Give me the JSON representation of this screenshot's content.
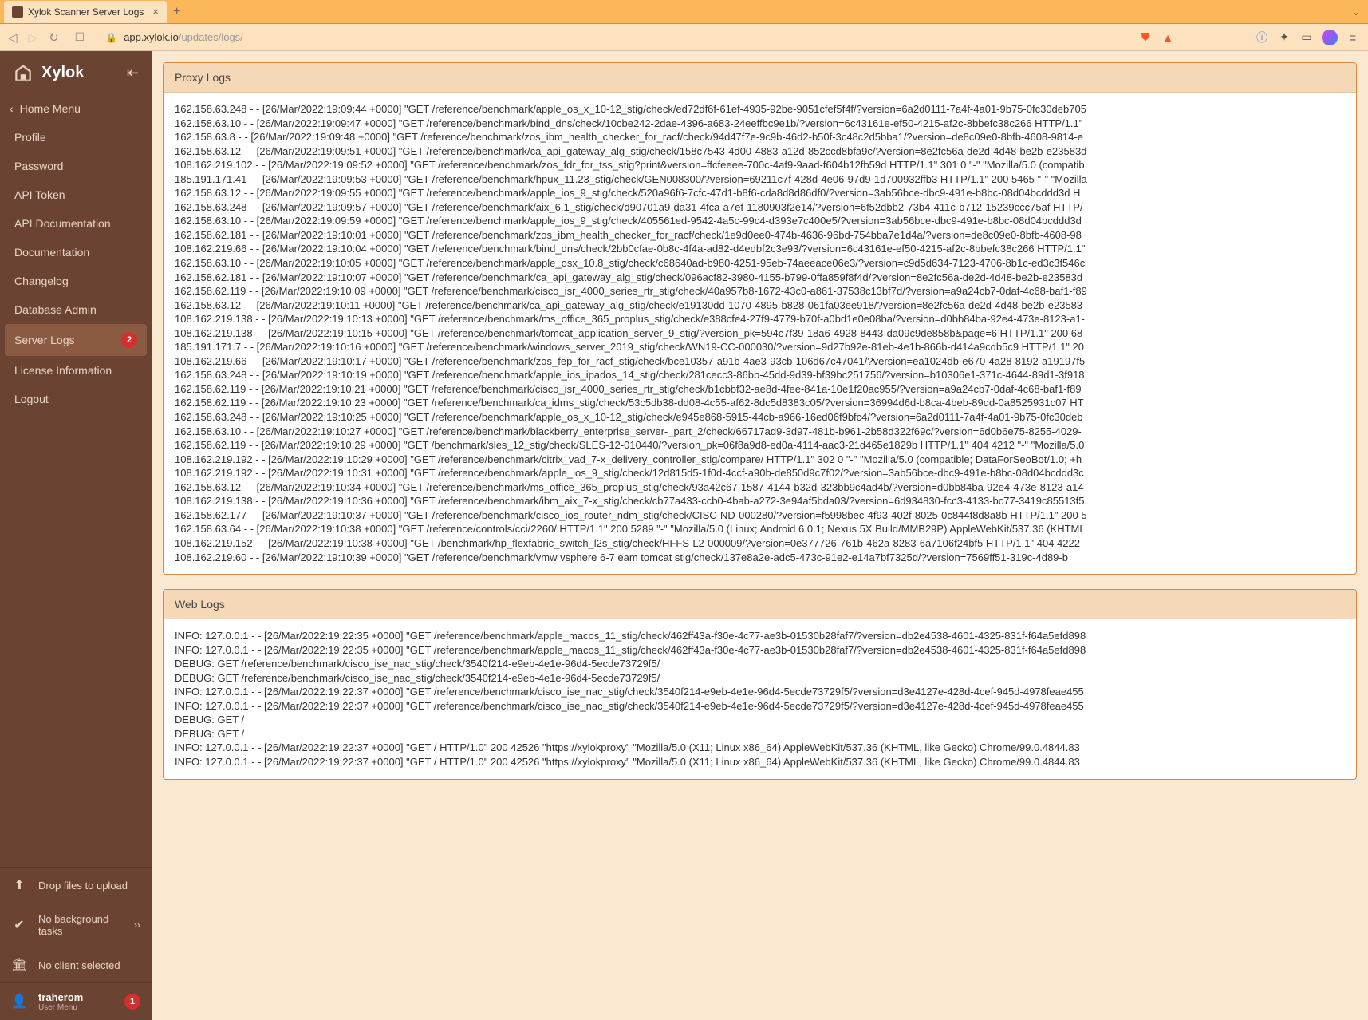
{
  "browser": {
    "tab_title": "Xylok Scanner Server Logs",
    "url_domain": "app.xylok.io",
    "url_path": "/updates/logs/"
  },
  "sidebar": {
    "brand": "Xylok",
    "home": "Home Menu",
    "items": [
      {
        "label": "Profile"
      },
      {
        "label": "Password"
      },
      {
        "label": "API Token"
      },
      {
        "label": "API Documentation"
      },
      {
        "label": "Documentation"
      },
      {
        "label": "Changelog"
      },
      {
        "label": "Database Admin"
      },
      {
        "label": "Server Logs",
        "badge": "2",
        "active": true
      },
      {
        "label": "License Information"
      },
      {
        "label": "Logout"
      }
    ],
    "drop_files": "Drop files to upload",
    "bg_tasks": "No background tasks",
    "client_selected": "No client selected",
    "user": {
      "name": "traherom",
      "sub": "User Menu",
      "badge": "1"
    }
  },
  "panels": {
    "proxy_title": "Proxy Logs",
    "web_title": "Web Logs"
  },
  "proxy_logs": [
    "162.158.63.248 - - [26/Mar/2022:19:09:44 +0000] \"GET /reference/benchmark/apple_os_x_10-12_stig/check/ed72df6f-61ef-4935-92be-9051cfef5f4f/?version=6a2d0111-7a4f-4a01-9b75-0fc30deb705",
    "162.158.63.10 - - [26/Mar/2022:19:09:47 +0000] \"GET /reference/benchmark/bind_dns/check/10cbe242-2dae-4396-a683-24eeffbc9e1b/?version=6c43161e-ef50-4215-af2c-8bbefc38c266 HTTP/1.1\"",
    "162.158.63.8 - - [26/Mar/2022:19:09:48 +0000] \"GET /reference/benchmark/zos_ibm_health_checker_for_racf/check/94d47f7e-9c9b-46d2-b50f-3c48c2d5bba1/?version=de8c09e0-8bfb-4608-9814-e",
    "162.158.63.12 - - [26/Mar/2022:19:09:51 +0000] \"GET /reference/benchmark/ca_api_gateway_alg_stig/check/158c7543-4d00-4883-a12d-852ccd8bfa9c/?version=8e2fc56a-de2d-4d48-be2b-e23583d",
    "108.162.219.102 - - [26/Mar/2022:19:09:52 +0000] \"GET /reference/benchmark/zos_fdr_for_tss_stig?print&version=ffcfeeee-700c-4af9-9aad-f604b12fb59d HTTP/1.1\" 301 0 \"-\" \"Mozilla/5.0 (compatib",
    "185.191.171.41 - - [26/Mar/2022:19:09:53 +0000] \"GET /reference/benchmark/hpux_11.23_stig/check/GEN008300/?version=69211c7f-428d-4e06-97d9-1d700932ffb3 HTTP/1.1\" 200 5465 \"-\" \"Mozilla",
    "162.158.63.12 - - [26/Mar/2022:19:09:55 +0000] \"GET /reference/benchmark/apple_ios_9_stig/check/520a96f6-7cfc-47d1-b8f6-cda8d8d86df0/?version=3ab56bce-dbc9-491e-b8bc-08d04bcddd3d H",
    "162.158.63.248 - - [26/Mar/2022:19:09:57 +0000] \"GET /reference/benchmark/aix_6.1_stig/check/d90701a9-da31-4fca-a7ef-1180903f2e14/?version=6f52dbb2-73b4-411c-b712-15239ccc75af HTTP/",
    "162.158.63.10 - - [26/Mar/2022:19:09:59 +0000] \"GET /reference/benchmark/apple_ios_9_stig/check/405561ed-9542-4a5c-99c4-d393e7c400e5/?version=3ab56bce-dbc9-491e-b8bc-08d04bcddd3d",
    "162.158.62.181 - - [26/Mar/2022:19:10:01 +0000] \"GET /reference/benchmark/zos_ibm_health_checker_for_racf/check/1e9d0ee0-474b-4636-96bd-754bba7e1d4a/?version=de8c09e0-8bfb-4608-98",
    "108.162.219.66 - - [26/Mar/2022:19:10:04 +0000] \"GET /reference/benchmark/bind_dns/check/2bb0cfae-0b8c-4f4a-ad82-d4edbf2c3e93/?version=6c43161e-ef50-4215-af2c-8bbefc38c266 HTTP/1.1\"",
    "162.158.63.10 - - [26/Mar/2022:19:10:05 +0000] \"GET /reference/benchmark/apple_osx_10.8_stig/check/c68640ad-b980-4251-95eb-74aeeace06e3/?version=c9d5d634-7123-4706-8b1c-ed3c3f546c",
    "162.158.62.181 - - [26/Mar/2022:19:10:07 +0000] \"GET /reference/benchmark/ca_api_gateway_alg_stig/check/096acf82-3980-4155-b799-0ffa859f8f4d/?version=8e2fc56a-de2d-4d48-be2b-e23583d",
    "162.158.62.119 - - [26/Mar/2022:19:10:09 +0000] \"GET /reference/benchmark/cisco_isr_4000_series_rtr_stig/check/40a957b8-1672-43c0-a861-37538c13bf7d/?version=a9a24cb7-0daf-4c68-baf1-f89",
    "162.158.63.12 - - [26/Mar/2022:19:10:11 +0000] \"GET /reference/benchmark/ca_api_gateway_alg_stig/check/e19130dd-1070-4895-b828-061fa03ee918/?version=8e2fc56a-de2d-4d48-be2b-e23583",
    "108.162.219.138 - - [26/Mar/2022:19:10:13 +0000] \"GET /reference/benchmark/ms_office_365_proplus_stig/check/e388cfe4-27f9-4779-b70f-a0bd1e0e08ba/?version=d0bb84ba-92e4-473e-8123-a1-",
    "108.162.219.138 - - [26/Mar/2022:19:10:15 +0000] \"GET /reference/benchmark/tomcat_application_server_9_stig/?version_pk=594c7f39-18a6-4928-8443-da09c9de858b&page=6 HTTP/1.1\" 200 68",
    "185.191.171.7 - - [26/Mar/2022:19:10:16 +0000] \"GET /reference/benchmark/windows_server_2019_stig/check/WN19-CC-000030/?version=9d27b92e-81eb-4e1b-866b-d414a9cdb5c9 HTTP/1.1\" 20",
    "108.162.219.66 - - [26/Mar/2022:19:10:17 +0000] \"GET /reference/benchmark/zos_fep_for_racf_stig/check/bce10357-a91b-4ae3-93cb-106d67c47041/?version=ea1024db-e670-4a28-8192-a19197f5",
    "162.158.63.248 - - [26/Mar/2022:19:10:19 +0000] \"GET /reference/benchmark/apple_ios_ipados_14_stig/check/281cecc3-86bb-45dd-9d39-bf39bc251756/?version=b10306e1-371c-4644-89d1-3f918",
    "162.158.62.119 - - [26/Mar/2022:19:10:21 +0000] \"GET /reference/benchmark/cisco_isr_4000_series_rtr_stig/check/b1cbbf32-ae8d-4fee-841a-10e1f20ac955/?version=a9a24cb7-0daf-4c68-baf1-f89",
    "162.158.62.119 - - [26/Mar/2022:19:10:23 +0000] \"GET /reference/benchmark/ca_idms_stig/check/53c5db38-dd08-4c55-af62-8dc5d8383c05/?version=36994d6d-b8ca-4beb-89dd-0a8525931c07 HT",
    "162.158.63.248 - - [26/Mar/2022:19:10:25 +0000] \"GET /reference/benchmark/apple_os_x_10-12_stig/check/e945e868-5915-44cb-a966-16ed06f9bfc4/?version=6a2d0111-7a4f-4a01-9b75-0fc30deb",
    "162.158.63.10 - - [26/Mar/2022:19:10:27 +0000] \"GET /reference/benchmark/blackberry_enterprise_server-_part_2/check/66717ad9-3d97-481b-b961-2b58d322f69c/?version=6d0b6e75-8255-4029-",
    "162.158.62.119 - - [26/Mar/2022:19:10:29 +0000] \"GET /benchmark/sles_12_stig/check/SLES-12-010440/?version_pk=06f8a9d8-ed0a-4114-aac3-21d465e1829b HTTP/1.1\" 404 4212 \"-\" \"Mozilla/5.0",
    "108.162.219.192 - - [26/Mar/2022:19:10:29 +0000] \"GET /reference/benchmark/citrix_vad_7-x_delivery_controller_stig/compare/ HTTP/1.1\" 302 0 \"-\" \"Mozilla/5.0 (compatible; DataForSeoBot/1.0; +h",
    "108.162.219.192 - - [26/Mar/2022:19:10:31 +0000] \"GET /reference/benchmark/apple_ios_9_stig/check/12d815d5-1f0d-4ccf-a90b-de850d9c7f02/?version=3ab56bce-dbc9-491e-b8bc-08d04bcddd3c",
    "162.158.63.12 - - [26/Mar/2022:19:10:34 +0000] \"GET /reference/benchmark/ms_office_365_proplus_stig/check/93a42c67-1587-4144-b32d-323bb9c4ad4b/?version=d0bb84ba-92e4-473e-8123-a14",
    "108.162.219.138 - - [26/Mar/2022:19:10:36 +0000] \"GET /reference/benchmark/ibm_aix_7-x_stig/check/cb77a433-ccb0-4bab-a272-3e94af5bda03/?version=6d934830-fcc3-4133-bc77-3419c85513f5",
    "162.158.62.177 - - [26/Mar/2022:19:10:37 +0000] \"GET /reference/benchmark/cisco_ios_router_ndm_stig/check/CISC-ND-000280/?version=f5998bec-4f93-402f-8025-0c844f8d8a8b HTTP/1.1\" 200 5",
    "162.158.63.64 - - [26/Mar/2022:19:10:38 +0000] \"GET /reference/controls/cci/2260/ HTTP/1.1\" 200 5289 \"-\" \"Mozilla/5.0 (Linux; Android 6.0.1; Nexus 5X Build/MMB29P) AppleWebKit/537.36 (KHTML",
    "108.162.219.152 - - [26/Mar/2022:19:10:38 +0000] \"GET /benchmark/hp_flexfabric_switch_l2s_stig/check/HFFS-L2-000009/?version=0e377726-761b-462a-8283-6a7106f24bf5 HTTP/1.1\" 404 4222",
    "108.162.219.60 - - [26/Mar/2022:19:10:39 +0000] \"GET /reference/benchmark/vmw vsphere 6-7 eam tomcat stig/check/137e8a2e-adc5-473c-91e2-e14a7bf7325d/?version=7569ff51-319c-4d89-b"
  ],
  "web_logs": [
    "INFO: 127.0.0.1 - - [26/Mar/2022:19:22:35 +0000] \"GET /reference/benchmark/apple_macos_11_stig/check/462ff43a-f30e-4c77-ae3b-01530b28faf7/?version=db2e4538-4601-4325-831f-f64a5efd898",
    "INFO: 127.0.0.1 - - [26/Mar/2022:19:22:35 +0000] \"GET /reference/benchmark/apple_macos_11_stig/check/462ff43a-f30e-4c77-ae3b-01530b28faf7/?version=db2e4538-4601-4325-831f-f64a5efd898",
    "DEBUG: GET /reference/benchmark/cisco_ise_nac_stig/check/3540f214-e9eb-4e1e-96d4-5ecde73729f5/",
    "DEBUG: GET /reference/benchmark/cisco_ise_nac_stig/check/3540f214-e9eb-4e1e-96d4-5ecde73729f5/",
    "INFO: 127.0.0.1 - - [26/Mar/2022:19:22:37 +0000] \"GET /reference/benchmark/cisco_ise_nac_stig/check/3540f214-e9eb-4e1e-96d4-5ecde73729f5/?version=d3e4127e-428d-4cef-945d-4978feae455",
    "INFO: 127.0.0.1 - - [26/Mar/2022:19:22:37 +0000] \"GET /reference/benchmark/cisco_ise_nac_stig/check/3540f214-e9eb-4e1e-96d4-5ecde73729f5/?version=d3e4127e-428d-4cef-945d-4978feae455",
    "DEBUG: GET /",
    "DEBUG: GET /",
    "INFO: 127.0.0.1 - - [26/Mar/2022:19:22:37 +0000] \"GET / HTTP/1.0\" 200 42526 \"https://xylokproxy\" \"Mozilla/5.0 (X11; Linux x86_64) AppleWebKit/537.36 (KHTML, like Gecko) Chrome/99.0.4844.83",
    "INFO: 127.0.0.1 - - [26/Mar/2022:19:22:37 +0000] \"GET / HTTP/1.0\" 200 42526 \"https://xylokproxy\" \"Mozilla/5.0 (X11; Linux x86_64) AppleWebKit/537.36 (KHTML, like Gecko) Chrome/99.0.4844.83"
  ]
}
